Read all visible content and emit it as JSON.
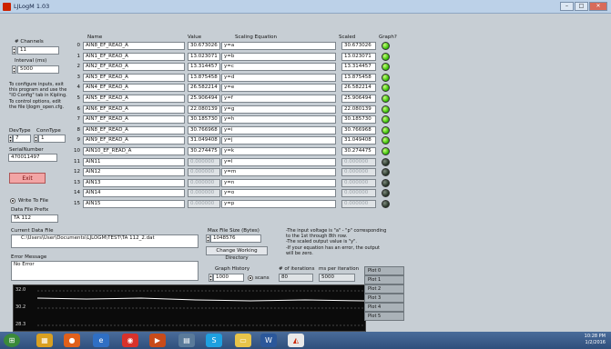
{
  "window": {
    "title": "LJLogM 1.03"
  },
  "left": {
    "channels_label": "# Channels",
    "channels_value": "11",
    "interval_label": "Interval (ms)",
    "interval_value": "5000",
    "instructions": "To configure inputs, exit this program and use the \"IO Config\" tab in Kipling. To control options, edit the file ljlogm_open.cfg.",
    "devtype_label": "DevType",
    "devtype_value": "7",
    "conntype_label": "ConnType",
    "conntype_value": "1",
    "serial_label": "SerialNumber",
    "serial_value": "470011497",
    "exit_label": "Exit",
    "write_to_file_label": "Write To File",
    "data_prefix_label": "Data File Prefix",
    "data_prefix_value": "TA 112",
    "current_file_label": "Current Data File",
    "current_file_value": "C:\\Users\\User\\Documents\\LJLOGM\\TEST\\TA 112_2.dat",
    "error_label": "Error Message",
    "error_value": "No Error"
  },
  "table": {
    "headers": {
      "name": "Name",
      "value": "Value",
      "equation": "Scaling Equation",
      "scaled": "Scaled",
      "graph": "Graph?"
    },
    "rows": [
      {
        "num": "0",
        "name": "AIN8_EF_READ_A",
        "value": "30.673026",
        "eq": "y=a",
        "scaled": "30.673026",
        "on": true
      },
      {
        "num": "1",
        "name": "AIN1_EF_READ_A",
        "value": "13.023071",
        "eq": "y=b",
        "scaled": "13.023071",
        "on": true
      },
      {
        "num": "2",
        "name": "AIN2_EF_READ_A",
        "value": "13.314457",
        "eq": "y=c",
        "scaled": "13.314457",
        "on": true
      },
      {
        "num": "3",
        "name": "AIN3_EF_READ_A",
        "value": "13.875458",
        "eq": "y=d",
        "scaled": "13.875458",
        "on": true
      },
      {
        "num": "4",
        "name": "AIN4_EF_READ_A",
        "value": "26.582214",
        "eq": "y=e",
        "scaled": "26.582214",
        "on": true
      },
      {
        "num": "5",
        "name": "AIN5_EF_READ_A",
        "value": "25.906494",
        "eq": "y=f",
        "scaled": "25.906494",
        "on": true
      },
      {
        "num": "6",
        "name": "AIN6_EF_READ_A",
        "value": "22.080139",
        "eq": "y=g",
        "scaled": "22.080139",
        "on": true
      },
      {
        "num": "7",
        "name": "AIN7_EF_READ_A",
        "value": "30.185730",
        "eq": "y=h",
        "scaled": "30.185730",
        "on": true
      },
      {
        "num": "8",
        "name": "AIN8_EF_READ_A",
        "value": "30.766968",
        "eq": "y=i",
        "scaled": "30.766968",
        "on": true
      },
      {
        "num": "9",
        "name": "AIN9_EF_READ_A",
        "value": "31.049408",
        "eq": "y=j",
        "scaled": "31.049408",
        "on": true
      },
      {
        "num": "10",
        "name": "AIN10_EF_READ_A",
        "value": "30.274475",
        "eq": "y=k",
        "scaled": "30.274475",
        "on": true
      },
      {
        "num": "11",
        "name": "AIN11",
        "value": "0.000000",
        "eq": "y=l",
        "scaled": "0.000000",
        "on": false
      },
      {
        "num": "12",
        "name": "AIN12",
        "value": "0.000000",
        "eq": "y=m",
        "scaled": "0.000000",
        "on": false
      },
      {
        "num": "13",
        "name": "AIN13",
        "value": "0.000000",
        "eq": "y=n",
        "scaled": "0.000000",
        "on": false
      },
      {
        "num": "14",
        "name": "AIN14",
        "value": "0.000000",
        "eq": "y=o",
        "scaled": "0.000000",
        "on": false
      },
      {
        "num": "15",
        "name": "AIN15",
        "value": "0.000000",
        "eq": "y=p",
        "scaled": "0.000000",
        "on": false
      }
    ]
  },
  "middle": {
    "max_file_label": "Max File Size (Bytes)",
    "max_file_value": "1048576",
    "change_dir_label": "Change Working Directory",
    "graph_history_label": "Graph History",
    "graph_history_value": "1000",
    "scans_label": "scans",
    "iterations_label": "# of iterations",
    "iterations_value": "80",
    "ms_per_iter_label": "ms per iteration",
    "ms_per_iter_value": "5000",
    "help_lines": [
      "-The input voltage is \"a\" - \"p\" corresponding",
      " to the 1st through 8th row.",
      "-The scaled output value is \"y\".",
      "-If your equation has an error, the output",
      " will be zero."
    ]
  },
  "graph": {
    "ticks": [
      "32.0",
      "30.2",
      "28.3"
    ],
    "line_color": "#ffffff",
    "background": "#0b0b0b"
  },
  "plots": [
    "Plot 0",
    "Plot 1",
    "Plot 2",
    "Plot 3",
    "Plot 4",
    "Plot 5"
  ],
  "taskbar": {
    "time": "10:28 PM",
    "date": "1/2/2016"
  }
}
